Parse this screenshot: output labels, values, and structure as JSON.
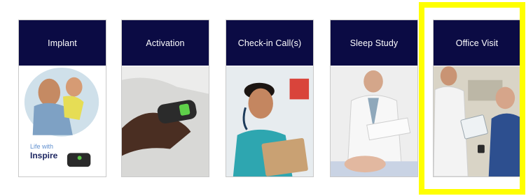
{
  "steps": [
    {
      "label": "Implant"
    },
    {
      "label": "Activation"
    },
    {
      "label": "Check-in Call(s)"
    },
    {
      "label": "Sleep Study"
    },
    {
      "label": "Office Visit"
    }
  ],
  "brand": {
    "tagline": "Life with",
    "logo": "Inspire"
  },
  "colors": {
    "header_bg": "#0b0b44",
    "header_text": "#ffffff",
    "highlight": "#ffff00"
  }
}
